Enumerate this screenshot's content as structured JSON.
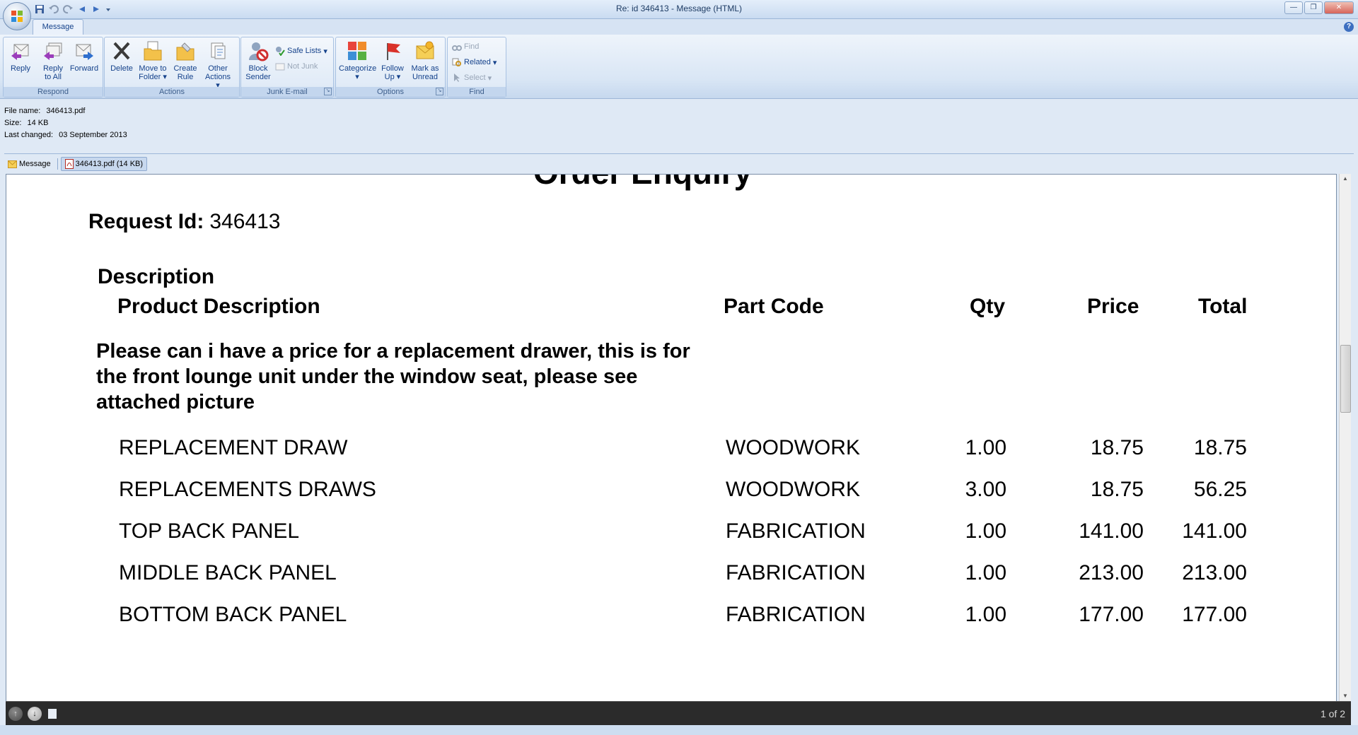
{
  "window": {
    "title": "Re: id 346413 - Message (HTML)"
  },
  "ribbon": {
    "tab": "Message",
    "groups": {
      "respond": {
        "label": "Respond",
        "reply": "Reply",
        "reply_all_1": "Reply",
        "reply_all_2": "to All",
        "forward": "Forward"
      },
      "actions": {
        "label": "Actions",
        "delete": "Delete",
        "move_1": "Move to",
        "move_2": "Folder",
        "create_1": "Create",
        "create_2": "Rule",
        "other_1": "Other",
        "other_2": "Actions"
      },
      "junk": {
        "label": "Junk E-mail",
        "block_1": "Block",
        "block_2": "Sender",
        "safe_lists": "Safe Lists",
        "not_junk": "Not Junk"
      },
      "options": {
        "label": "Options",
        "categorize": "Categorize",
        "follow_1": "Follow",
        "follow_2": "Up",
        "mark_1": "Mark as",
        "mark_2": "Unread"
      },
      "find": {
        "label": "Find",
        "find": "Find",
        "related": "Related",
        "select": "Select"
      }
    }
  },
  "file_info": {
    "name_label": "File name:",
    "name": "346413.pdf",
    "size_label": "Size:",
    "size": "14 KB",
    "changed_label": "Last changed:",
    "changed": "03 September 2013"
  },
  "attachments": {
    "message_tab": "Message",
    "pdf_tab": "346413.pdf (14 KB)"
  },
  "document": {
    "heading": "Order Enquiry",
    "request_label": "Request Id:",
    "request_id": "346413",
    "description_header": "Description",
    "columns": {
      "product": "Product Description",
      "part": "Part Code",
      "qty": "Qty",
      "price": "Price",
      "total": "Total"
    },
    "description_text": "Please can i have a price for a replacement drawer, this is for the front lounge unit under the window seat, please see attached picture",
    "items": [
      {
        "desc": "REPLACEMENT DRAW",
        "part": "WOODWORK",
        "qty": "1.00",
        "price": "18.75",
        "total": "18.75"
      },
      {
        "desc": "REPLACEMENTS DRAWS",
        "part": "WOODWORK",
        "qty": "3.00",
        "price": "18.75",
        "total": "56.25"
      },
      {
        "desc": "TOP BACK PANEL",
        "part": "FABRICATION",
        "qty": "1.00",
        "price": "141.00",
        "total": "141.00"
      },
      {
        "desc": "MIDDLE BACK PANEL",
        "part": "FABRICATION",
        "qty": "1.00",
        "price": "213.00",
        "total": "213.00"
      },
      {
        "desc": "BOTTOM BACK PANEL",
        "part": "FABRICATION",
        "qty": "1.00",
        "price": "177.00",
        "total": "177.00"
      }
    ]
  },
  "viewer": {
    "page_indicator": "1 of 2"
  }
}
